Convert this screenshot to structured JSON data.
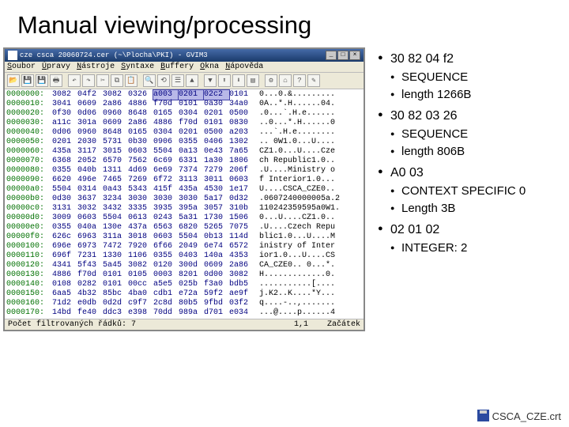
{
  "title": "Manual viewing/processing",
  "editor": {
    "titlebar": "cze csca 20060724.cer (~\\Plocha\\PKI) - GVIM3",
    "menu": [
      "Soubor",
      "Úpravy",
      "Nástroje",
      "Syntaxe",
      "Buffery",
      "Okna",
      "Nápověda"
    ],
    "toolbar_icons": [
      "open",
      "save",
      "save-all",
      "print",
      "undo",
      "redo",
      "cut",
      "copy",
      "paste",
      "search",
      "replace",
      "new",
      "up",
      "down",
      "load",
      "load2",
      "shell",
      "make",
      "tag",
      "help",
      "find"
    ],
    "rows": [
      {
        "addr": "0000000:",
        "hex": [
          "3082",
          "04f2",
          "3082",
          "0326",
          "a003",
          "0201",
          "02c2",
          "0101"
        ],
        "asc": "0...0.&........."
      },
      {
        "addr": "0000010:",
        "hex": [
          "3041",
          "0609",
          "2a86",
          "4886",
          "f70d",
          "0101",
          "0a30",
          "34a0"
        ],
        "asc": "0A..*.H......04."
      },
      {
        "addr": "0000020:",
        "hex": [
          "0f30",
          "0d06",
          "0960",
          "8648",
          "0165",
          "0304",
          "0201",
          "0500"
        ],
        "asc": ".0...`.H.e......"
      },
      {
        "addr": "0000030:",
        "hex": [
          "a11c",
          "301a",
          "0609",
          "2a86",
          "4886",
          "f70d",
          "0101",
          "0830"
        ],
        "asc": "..0...*.H......0"
      },
      {
        "addr": "0000040:",
        "hex": [
          "0d06",
          "0960",
          "8648",
          "0165",
          "0304",
          "0201",
          "0500",
          "a203"
        ],
        "asc": "...`.H.e........"
      },
      {
        "addr": "0000050:",
        "hex": [
          "0201",
          "2030",
          "5731",
          "0b30",
          "0906",
          "0355",
          "0406",
          "1302"
        ],
        "asc": ".. 0W1.0...U...."
      },
      {
        "addr": "0000060:",
        "hex": [
          "435a",
          "3117",
          "3015",
          "0603",
          "5504",
          "0a13",
          "0e43",
          "7a65"
        ],
        "asc": "CZ1.0...U....Cze"
      },
      {
        "addr": "0000070:",
        "hex": [
          "6368",
          "2052",
          "6570",
          "7562",
          "6c69",
          "6331",
          "1a30",
          "1806"
        ],
        "asc": "ch Republic1.0.."
      },
      {
        "addr": "0000080:",
        "hex": [
          "0355",
          "040b",
          "1311",
          "4d69",
          "6e69",
          "7374",
          "7279",
          "206f"
        ],
        "asc": ".U....Ministry o"
      },
      {
        "addr": "0000090:",
        "hex": [
          "6620",
          "496e",
          "7465",
          "7269",
          "6f72",
          "3113",
          "3011",
          "0603"
        ],
        "asc": "f Interior1.0..."
      },
      {
        "addr": "00000a0:",
        "hex": [
          "5504",
          "0314",
          "0a43",
          "5343",
          "415f",
          "435a",
          "4530",
          "1e17"
        ],
        "asc": "U....CSCA_CZE0.."
      },
      {
        "addr": "00000b0:",
        "hex": [
          "0d30",
          "3637",
          "3234",
          "3030",
          "3030",
          "3030",
          "5a17",
          "0d32"
        ],
        "asc": ".0607240000005a.2"
      },
      {
        "addr": "00000c0:",
        "hex": [
          "3131",
          "3032",
          "3432",
          "3335",
          "3935",
          "395a",
          "3057",
          "310b"
        ],
        "asc": "110242359595a0W1."
      },
      {
        "addr": "00000d0:",
        "hex": [
          "3009",
          "0603",
          "5504",
          "0613",
          "0243",
          "5a31",
          "1730",
          "1506"
        ],
        "asc": "0...U....CZ1.0.."
      },
      {
        "addr": "00000e0:",
        "hex": [
          "0355",
          "040a",
          "130e",
          "437a",
          "6563",
          "6820",
          "5265",
          "7075"
        ],
        "asc": ".U....Czech Repu"
      },
      {
        "addr": "00000f0:",
        "hex": [
          "626c",
          "6963",
          "311a",
          "3018",
          "0603",
          "5504",
          "0b13",
          "114d"
        ],
        "asc": "blic1.0...U....M"
      },
      {
        "addr": "0000100:",
        "hex": [
          "696e",
          "6973",
          "7472",
          "7920",
          "6f66",
          "2049",
          "6e74",
          "6572"
        ],
        "asc": "inistry of Inter"
      },
      {
        "addr": "0000110:",
        "hex": [
          "696f",
          "7231",
          "1330",
          "1106",
          "0355",
          "0403",
          "140a",
          "4353"
        ],
        "asc": "ior1.0...U....CS"
      },
      {
        "addr": "0000120:",
        "hex": [
          "4341",
          "5f43",
          "5a45",
          "3082",
          "0120",
          "300d",
          "0609",
          "2a86"
        ],
        "asc": "CA_CZE0.. 0...*."
      },
      {
        "addr": "0000130:",
        "hex": [
          "4886",
          "f70d",
          "0101",
          "0105",
          "0003",
          "8201",
          "0d00",
          "3082"
        ],
        "asc": "H.............0."
      },
      {
        "addr": "0000140:",
        "hex": [
          "0108",
          "0282",
          "0101",
          "00cc",
          "a5e5",
          "025b",
          "f3a0",
          "bdb5"
        ],
        "asc": "...........[...."
      },
      {
        "addr": "0000150:",
        "hex": [
          "6aa5",
          "4b32",
          "85bc",
          "4ba0",
          "cdb1",
          "e72a",
          "59f2",
          "ae9f"
        ],
        "asc": "j.K2..K....*Y..."
      },
      {
        "addr": "0000160:",
        "hex": [
          "71d2",
          "e0db",
          "0d2d",
          "c9f7",
          "2c8d",
          "80b5",
          "9fbd",
          "03f2"
        ],
        "asc": "q....-..,......."
      },
      {
        "addr": "0000170:",
        "hex": [
          "14bd",
          "fe40",
          "ddc3",
          "e398",
          "70dd",
          "989a",
          "d701",
          "e034"
        ],
        "asc": "...@....p......4"
      }
    ],
    "hl_row": 0,
    "hl_cols": [
      4,
      5,
      6
    ],
    "status_left": "Počet filtrovaných řádků: 7",
    "status_mid": "1,1",
    "status_right": "Začátek"
  },
  "notes": [
    {
      "t": "30 82 04 f2",
      "sub": [
        "SEQUENCE",
        "length 1266B"
      ]
    },
    {
      "t": "30 82 03 26",
      "sub": [
        "SEQUENCE",
        "length 806B"
      ]
    },
    {
      "t": "A0 03",
      "sub": [
        "CONTEXT SPECIFIC 0",
        "Length 3B"
      ]
    },
    {
      "t": "02 01 02",
      "sub": [
        "INTEGER: 2"
      ]
    }
  ],
  "footer": "CSCA_CZE.crt"
}
